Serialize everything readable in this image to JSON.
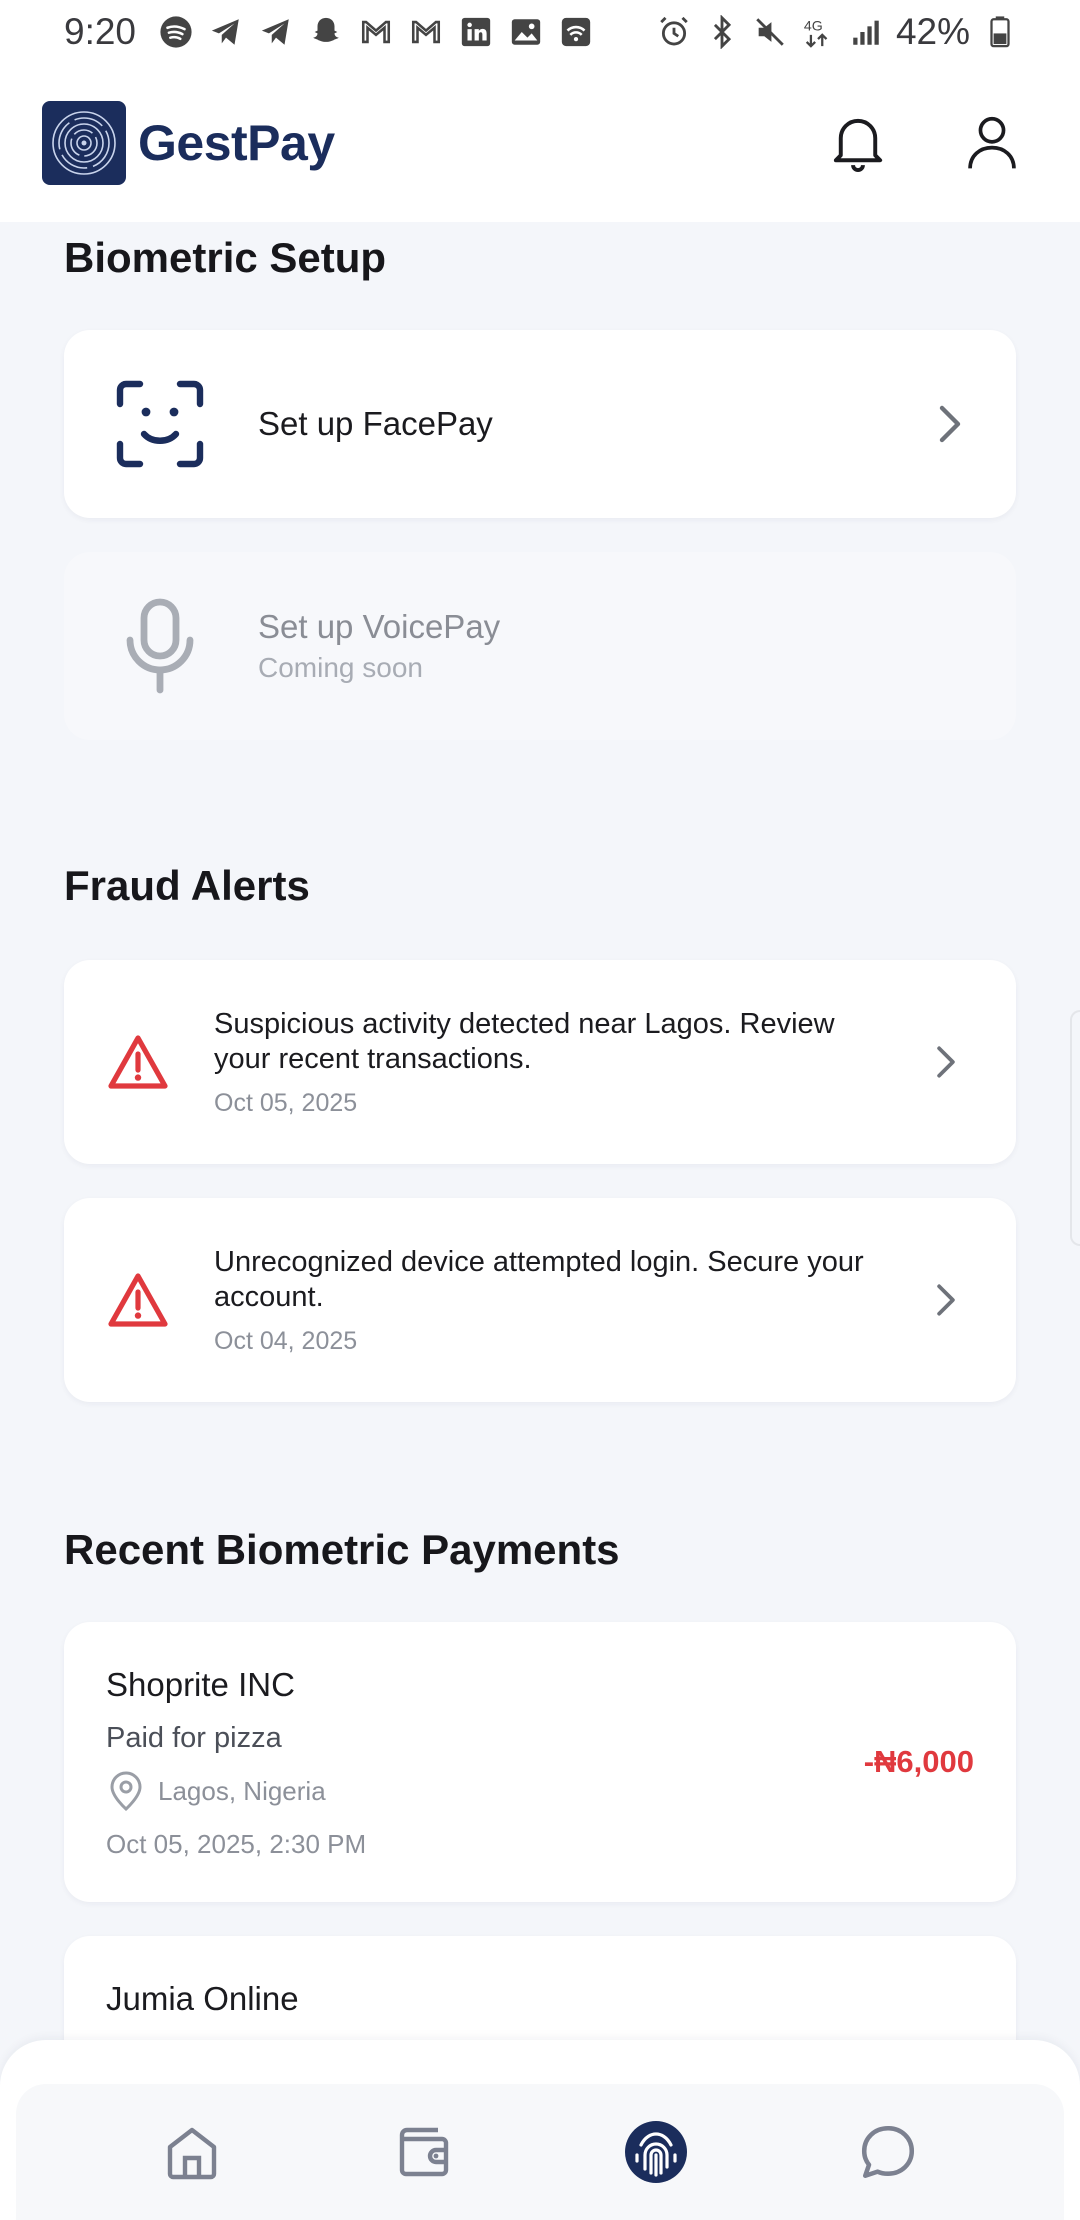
{
  "status_bar": {
    "time": "9:20",
    "left_icons": [
      "spotify-icon",
      "telegram-icon",
      "telegram-icon",
      "snapchat-icon",
      "gmail-icon",
      "gmail-icon",
      "linkedin-icon",
      "gallery-icon",
      "wifi-hotspot-icon"
    ],
    "right_icons": [
      "alarm-icon",
      "bluetooth-icon",
      "mute-icon",
      "4g-icon",
      "signal-icon"
    ],
    "battery_percent": "42%"
  },
  "header": {
    "brand": "GestPay",
    "brand_color": "#1b2d5c",
    "actions": [
      "bell-icon",
      "user-icon"
    ]
  },
  "biometric_setup": {
    "title": "Biometric Setup",
    "items": [
      {
        "label": "Set up FacePay",
        "icon": "face-scan-icon",
        "enabled": true
      },
      {
        "label": "Set up VoicePay",
        "sublabel": "Coming soon",
        "icon": "microphone-icon",
        "enabled": false
      }
    ]
  },
  "fraud_alerts": {
    "title": "Fraud Alerts",
    "alert_color": "#e0393e",
    "items": [
      {
        "message": "Suspicious activity detected near Lagos. Review your recent transactions.",
        "date": "Oct 05, 2025"
      },
      {
        "message": "Unrecognized device attempted login. Secure your account.",
        "date": "Oct 04, 2025"
      }
    ]
  },
  "recent_payments": {
    "title": "Recent Biometric Payments",
    "items": [
      {
        "merchant": "Shoprite INC",
        "description": "Paid for pizza",
        "location": "Lagos, Nigeria",
        "datetime": "Oct 05, 2025, 2:30 PM",
        "amount": "-₦6,000"
      },
      {
        "merchant": "Jumia Online"
      }
    ]
  },
  "bottom_nav": {
    "items": [
      "home-icon",
      "wallet-icon",
      "fingerprint-icon",
      "chat-icon"
    ],
    "active": "fingerprint-icon"
  }
}
